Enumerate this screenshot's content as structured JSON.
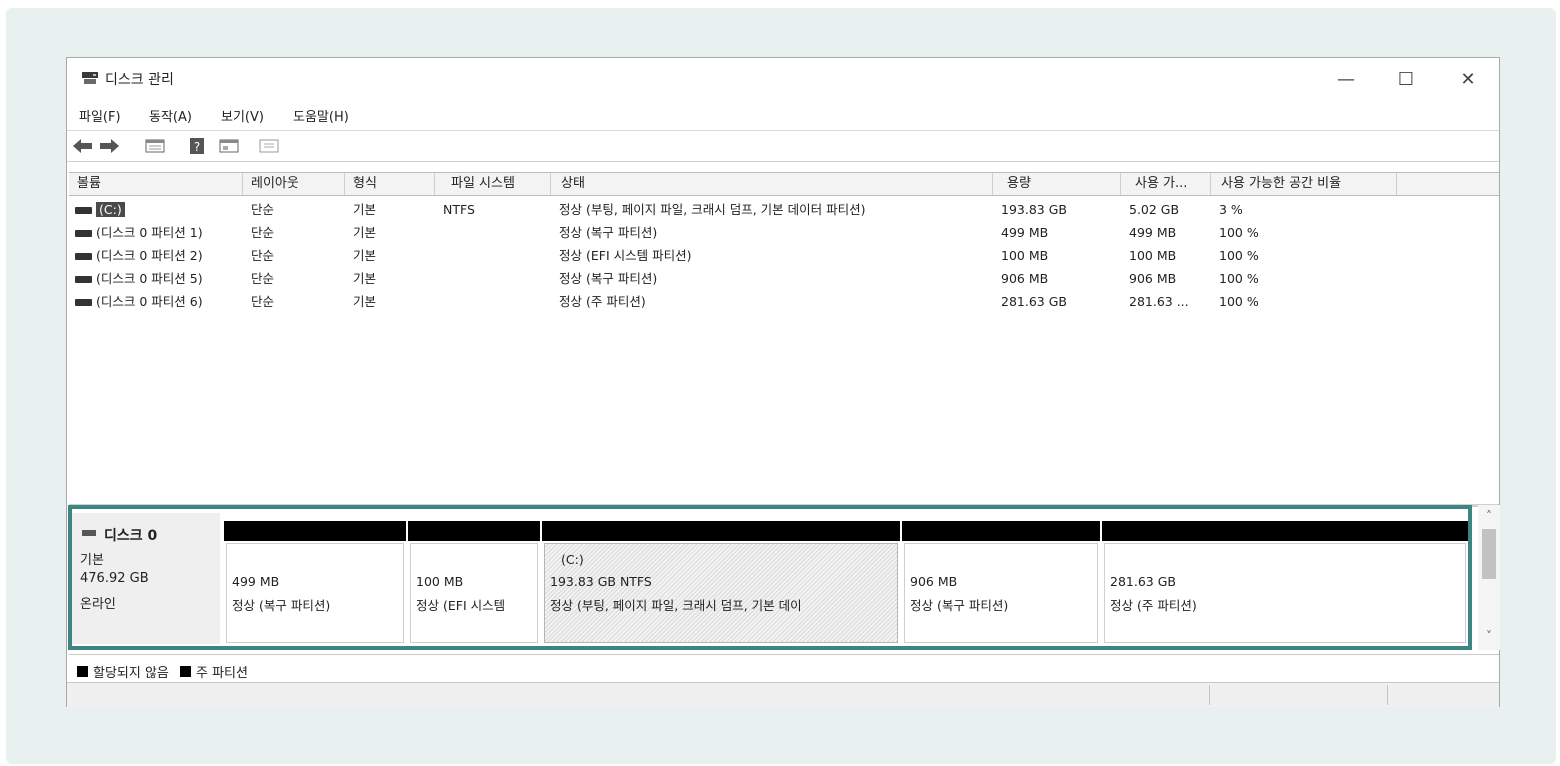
{
  "window": {
    "title": "디스크 관리",
    "controls": {
      "minimize": "—",
      "maximize": "☐",
      "close": "✕"
    }
  },
  "menu": [
    "파일(F)",
    "동작(A)",
    "보기(V)",
    "도움말(H)"
  ],
  "toolbar": {
    "icons": [
      "back-arrow-icon",
      "forward-arrow-icon",
      "disk-list-icon",
      "help-icon",
      "properties-icon",
      "view-icon"
    ],
    "help_glyph": "?"
  },
  "volume_list": {
    "columns": [
      "볼륨",
      "레이아웃",
      "형식",
      "파일 시스템",
      "상태",
      "용량",
      "사용 가...",
      "사용 가능한 공간 비율"
    ],
    "rows": [
      {
        "volume": "(C:)",
        "layout": "단순",
        "type": "기본",
        "fs": "NTFS",
        "status": "정상 (부팅, 페이지 파일, 크래시 덤프, 기본 데이터 파티션)",
        "capacity": "193.83 GB",
        "free": "5.02 GB",
        "pct": "3 %",
        "selected": true
      },
      {
        "volume": "(디스크 0 파티션 1)",
        "layout": "단순",
        "type": "기본",
        "fs": "",
        "status": "정상 (복구 파티션)",
        "capacity": "499 MB",
        "free": "499 MB",
        "pct": "100 %",
        "selected": false
      },
      {
        "volume": "(디스크 0 파티션 2)",
        "layout": "단순",
        "type": "기본",
        "fs": "",
        "status": "정상 (EFI 시스템 파티션)",
        "capacity": "100 MB",
        "free": "100 MB",
        "pct": "100 %",
        "selected": false
      },
      {
        "volume": "(디스크 0 파티션 5)",
        "layout": "단순",
        "type": "기본",
        "fs": "",
        "status": "정상 (복구 파티션)",
        "capacity": "906 MB",
        "free": "906 MB",
        "pct": "100 %",
        "selected": false
      },
      {
        "volume": "(디스크 0 파티션 6)",
        "layout": "단순",
        "type": "기본",
        "fs": "",
        "status": "정상 (주 파티션)",
        "capacity": "281.63 GB",
        "free": "281.63 ...",
        "pct": "100 %",
        "selected": false
      }
    ]
  },
  "disk": {
    "name": "디스크 0",
    "type": "기본",
    "size": "476.92 GB",
    "state": "온라인",
    "partitions": [
      {
        "label": "",
        "size": "499 MB",
        "status": "정상 (복구 파티션)",
        "hatched": false
      },
      {
        "label": "",
        "size": "100 MB",
        "status": "정상 (EFI 시스템",
        "hatched": false
      },
      {
        "label": "(C:)",
        "size": "193.83 GB NTFS",
        "status": "정상 (부팅, 페이지 파일, 크래시 덤프, 기본 데이",
        "hatched": true
      },
      {
        "label": "",
        "size": "906 MB",
        "status": "정상 (복구 파티션)",
        "hatched": false
      },
      {
        "label": "",
        "size": "281.63 GB",
        "status": "정상 (주 파티션)",
        "hatched": false
      }
    ]
  },
  "scrollbar": {
    "up": "˄",
    "down": "˅"
  },
  "legend": [
    "할당되지 않음",
    "주 파티션"
  ],
  "colors": {
    "accent_frame": "#3c8582",
    "partition_header": "#000000",
    "selected_bg": "#4a4a4a"
  }
}
